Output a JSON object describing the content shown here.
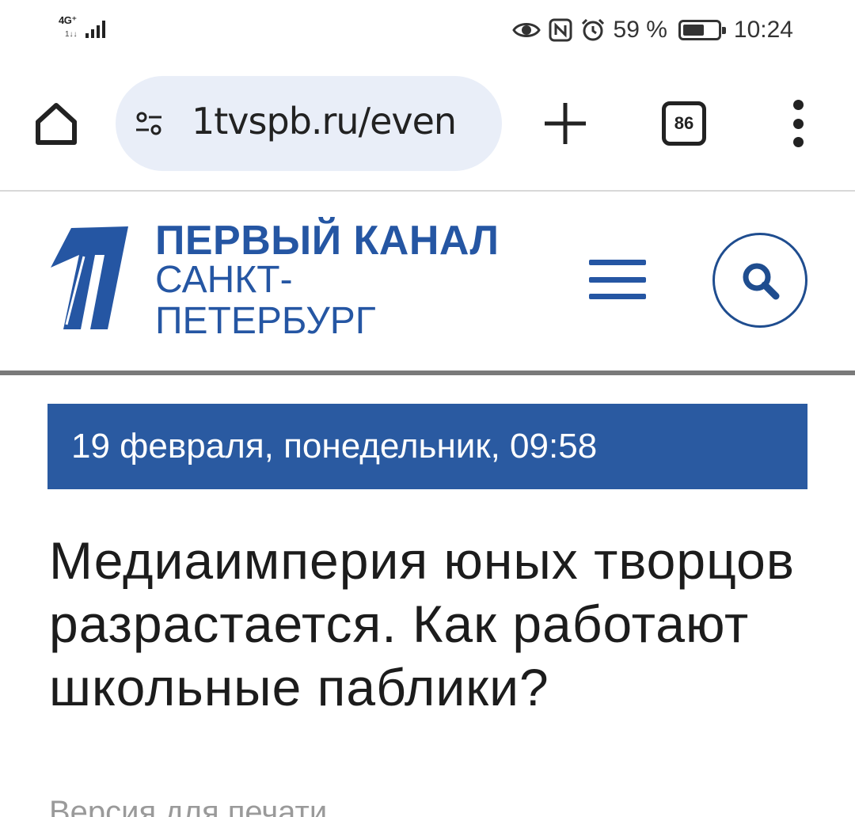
{
  "status_bar": {
    "network": "4G⁺",
    "network_sub": "1↓↓",
    "battery_percent": "59 %",
    "time": "10:24",
    "icons": [
      "signal-icon",
      "eye-icon",
      "nfc-icon",
      "alarm-icon",
      "battery-icon"
    ]
  },
  "browser": {
    "url": "1tvspb.ru/even",
    "tab_count": "86",
    "icons": [
      "home-icon",
      "site-settings-icon",
      "new-tab-icon",
      "tabs-icon",
      "more-icon"
    ]
  },
  "site": {
    "brand_name": "ПЕРВЫЙ КАНАЛ",
    "brand_city": "САНКТ-ПЕТЕРБУРГ",
    "brand_color": "#2556a3",
    "icons": [
      "channel-one-logo-icon",
      "hamburger-menu-icon",
      "search-icon"
    ]
  },
  "date_banner": {
    "text": "19 февраля, понедельник, 09:58",
    "background": "#2a5aa1"
  },
  "article": {
    "title": "Медиаимперия юных творцов разрастается. Как работают школьные паблики?",
    "print_link": "Версия для печати"
  }
}
